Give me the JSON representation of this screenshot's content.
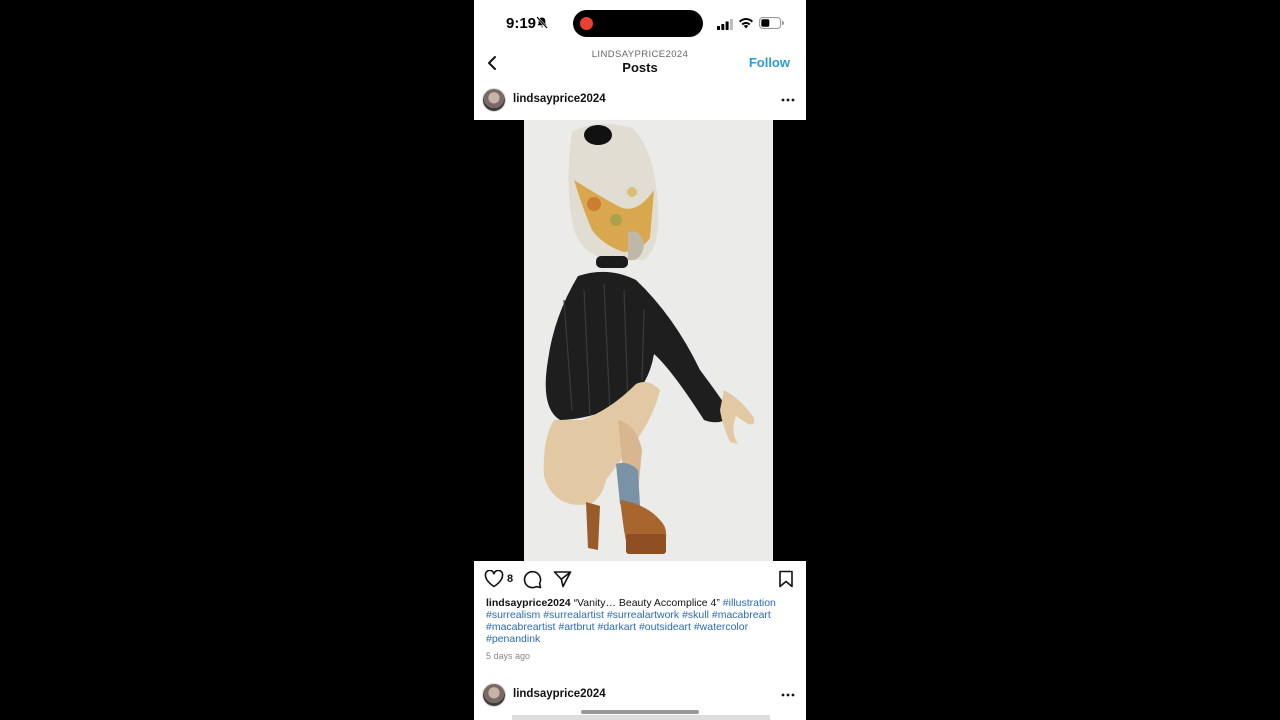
{
  "status_bar": {
    "time": "9:19",
    "icons": [
      "bell-slash-icon",
      "signal-icon",
      "wifi-icon",
      "battery-icon"
    ],
    "recording_color": "#e8412f"
  },
  "nav": {
    "back_icon": "chevron-left-icon",
    "username": "LINDSAYPRICE2024",
    "title": "Posts",
    "follow_label": "Follow",
    "accent_color": "#2b9ad8"
  },
  "post": {
    "username": "lindsayprice2024",
    "more_icon": "ellipsis-icon",
    "like_count": "8",
    "actions": [
      "heart-icon",
      "comment-icon",
      "share-icon",
      "bookmark-icon"
    ],
    "caption_text": "“Vanity… Beauty Accomplice 4”",
    "hashtags": [
      "#illustration",
      "#surrealism",
      "#surrealartist",
      "#surrealartwork",
      "#skull",
      "#macabreart",
      "#macabreartist",
      "#artbrut",
      "#darkart",
      "#outsideart",
      "#watercolor",
      "#penandink"
    ],
    "time_ago": "5 days ago"
  },
  "next_post": {
    "username": "lindsayprice2024"
  }
}
